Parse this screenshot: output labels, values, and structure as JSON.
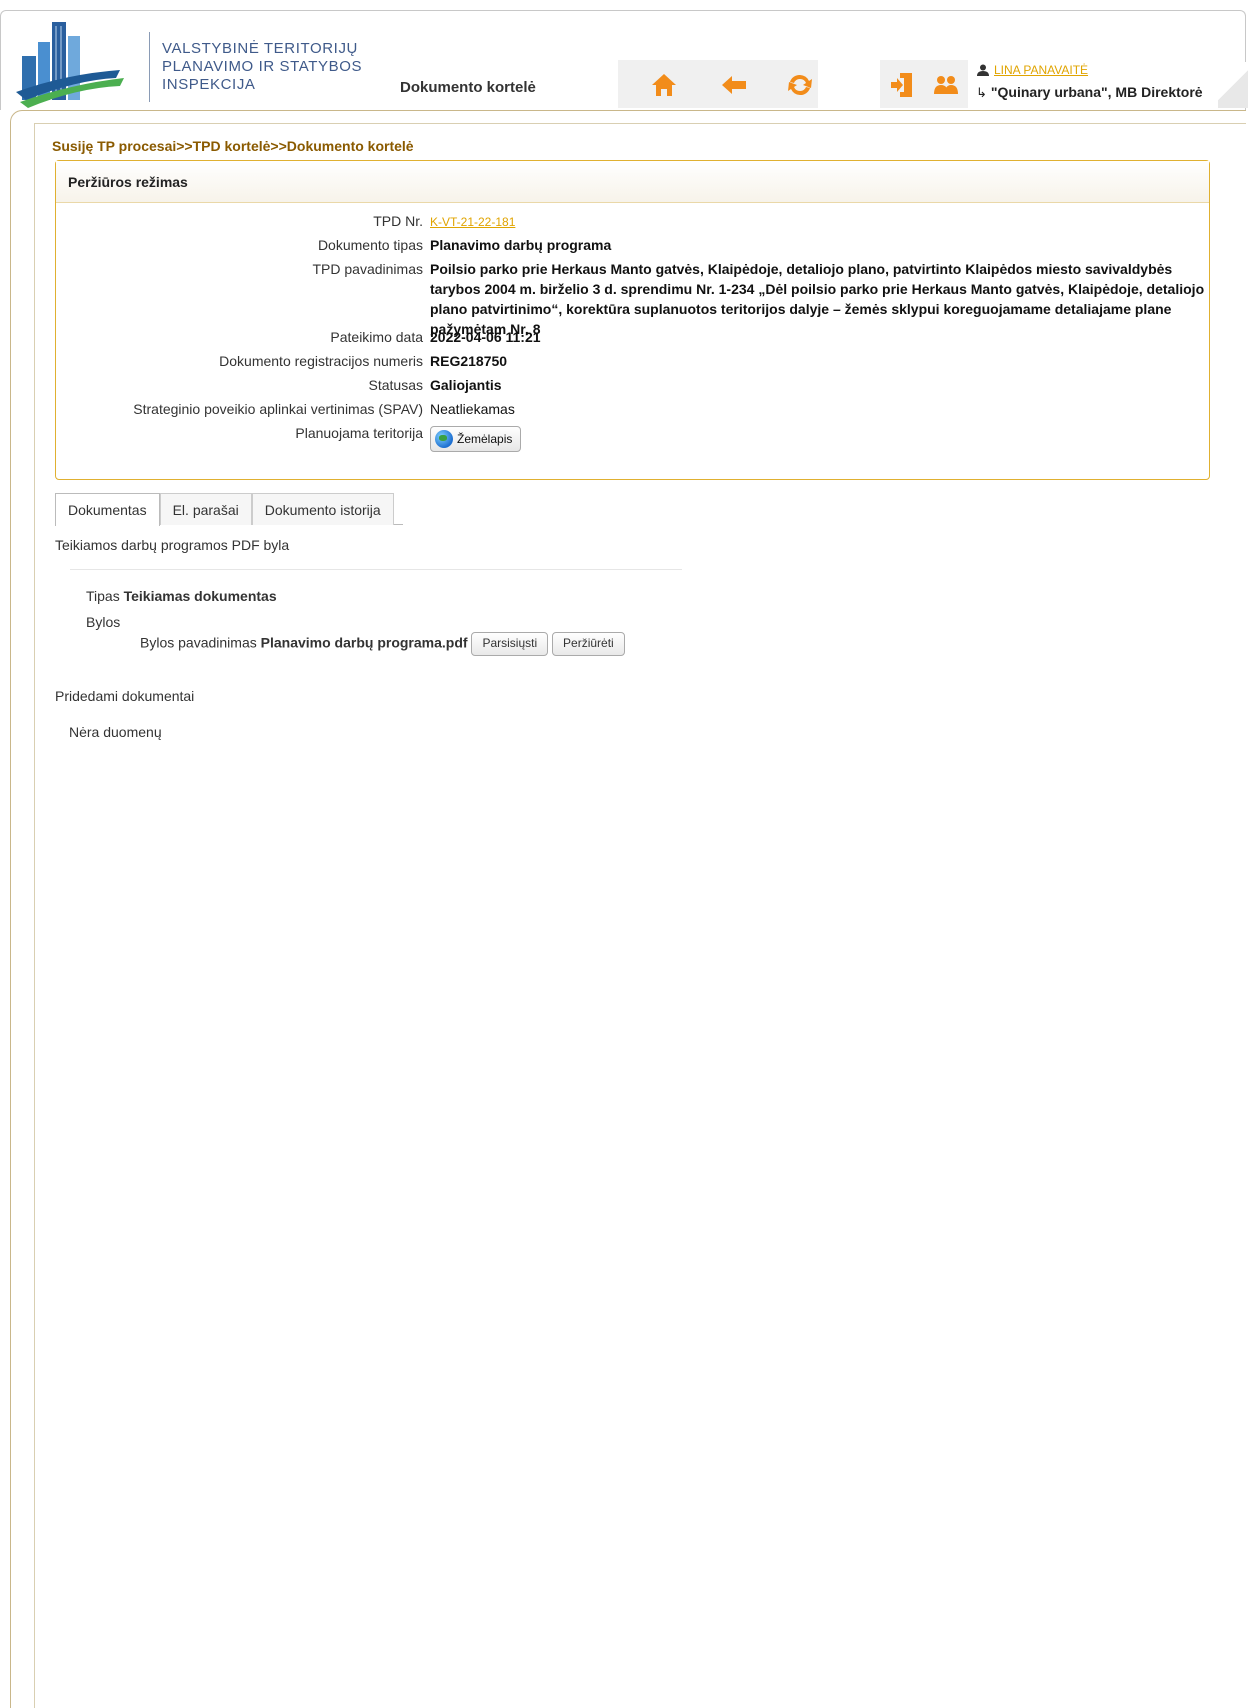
{
  "header": {
    "agency_lines": [
      "VALSTYBINĖ TERITORIJŲ",
      "PLANAVIMO IR STATYBOS",
      "INSPEKCIJA"
    ],
    "page_title": "Dokumento kortelė",
    "user_name": "LINA PANAVAITĖ",
    "organization": "\"Quinary urbana\", MB Direktorė",
    "icons": [
      "home-icon",
      "back-arrow-icon",
      "refresh-icon",
      "logout-icon",
      "users-icon",
      "user-icon",
      "sub-arrow-icon"
    ]
  },
  "breadcrumb": {
    "items": [
      "Susiję TP procesai",
      "TPD kortelė",
      "Dokumento kortelė"
    ],
    "separator": ">>"
  },
  "view_panel": {
    "title": "Peržiūros režimas",
    "fields": {
      "tpd_nr": {
        "label": "TPD Nr.",
        "value": "K-VT-21-22-181"
      },
      "doc_type": {
        "label": "Dokumento tipas",
        "value": "Planavimo darbų programa"
      },
      "tpd_name": {
        "label": "TPD pavadinimas",
        "value": "Poilsio parko prie Herkaus Manto gatvės, Klaipėdoje, detaliojo plano, patvirtinto Klaipėdos miesto savivaldybės tarybos 2004 m. birželio 3 d. sprendimu Nr. 1-234 „Dėl poilsio parko prie Herkaus Manto gatvės, Klaipėdoje, detaliojo plano patvirtinimo“, korektūra suplanuotos teritorijos dalyje – žemės sklypui koreguojamame detaliajame plane pažymėtam Nr. 8"
      },
      "submit_date": {
        "label": "Pateikimo data",
        "value": "2022-04-06 11:21"
      },
      "reg_number": {
        "label": "Dokumento registracijos numeris",
        "value": "REG218750"
      },
      "status": {
        "label": "Statusas",
        "value": "Galiojantis"
      },
      "spav": {
        "label": "Strateginio poveikio aplinkai vertinimas (SPAV)",
        "value": "Neatliekamas"
      },
      "territory": {
        "label": "Planuojama teritorija",
        "button": "Žemėlapis"
      }
    }
  },
  "tabs": [
    {
      "label": "Dokumentas",
      "active": true
    },
    {
      "label": "El. parašai",
      "active": false
    },
    {
      "label": "Dokumento istorija",
      "active": false
    }
  ],
  "document": {
    "heading": "Teikiamos darbų programos PDF byla",
    "type_label": "Tipas",
    "type_value": "Teikiamas dokumentas",
    "files_label": "Bylos",
    "file_name_label": "Bylos pavadinimas",
    "file_name": "Planavimo darbų programa.pdf",
    "download_button": "Parsisiųsti",
    "view_button": "Peržiūrėti"
  },
  "attachments": {
    "heading": "Pridedami dokumentai",
    "empty_text": "Nėra duomenų"
  },
  "colors": {
    "accent_orange": "#f28c1a",
    "link_gold": "#e0a400",
    "breadcrumb_brown": "#8a5a00",
    "panel_border": "#e0b030",
    "agency_blue": "#3f5a8a"
  }
}
